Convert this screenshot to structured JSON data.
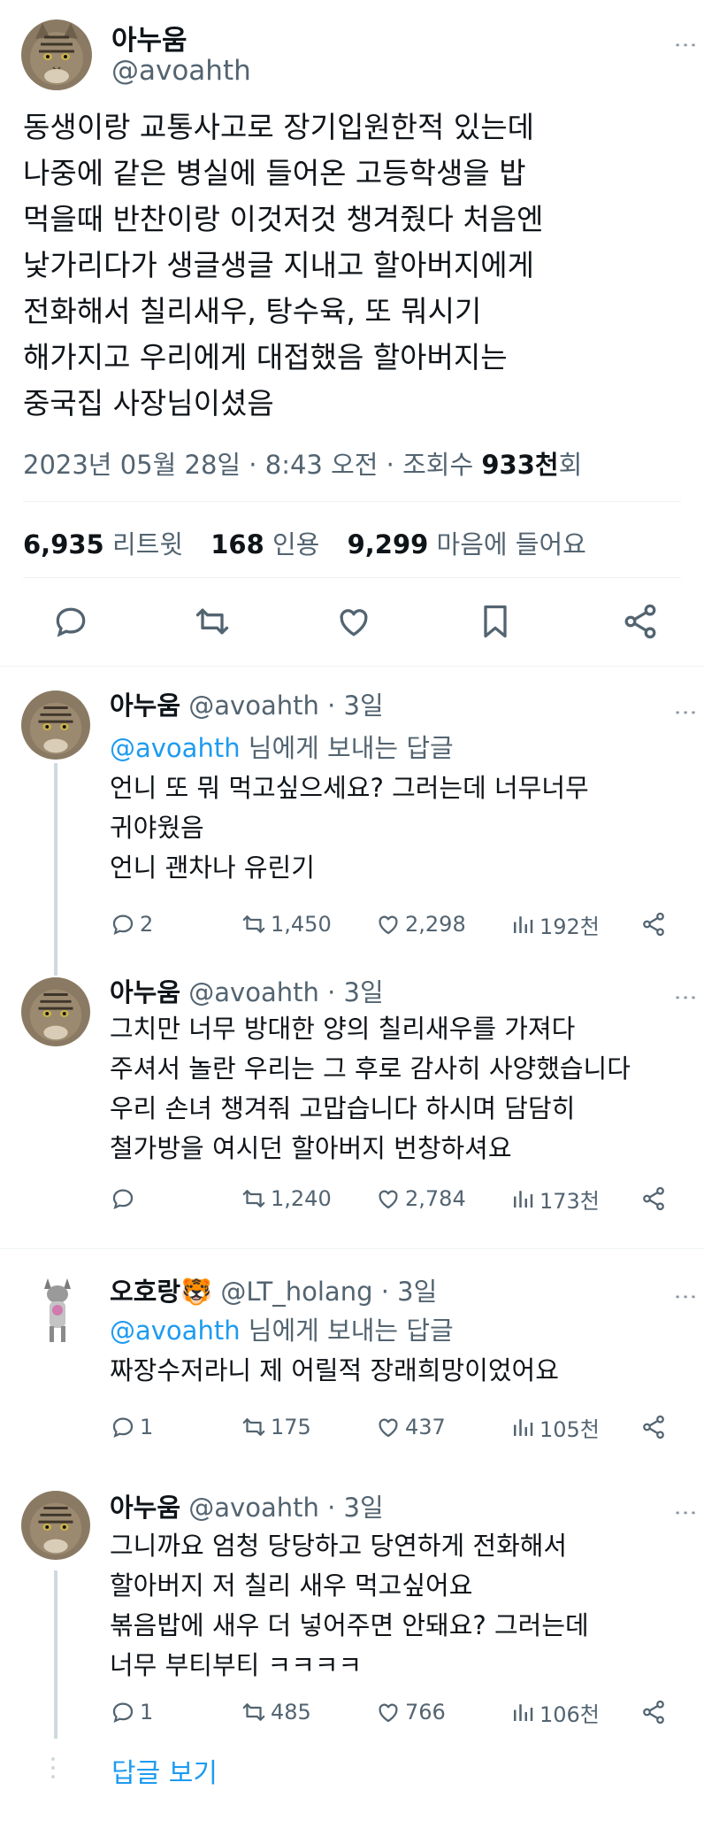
{
  "main": {
    "display_name": "아누움",
    "handle": "@avoahth",
    "text": "동생이랑 교통사고로 장기입원한적 있는데\n나중에 같은 병실에 들어온 고등학생을 밥\n먹을때 반찬이랑 이것저것 챙겨줬다 처음엔\n낯가리다가 생글생글 지내고 할아버지에게\n전화해서 칠리새우, 탕수육, 또 뭐시기\n해가지고 우리에게 대접했음 할아버지는\n중국집 사장님이셨음",
    "meta_date": "2023년 05월 28일 · 8:43 오전 · 조회수 ",
    "meta_views": "933천",
    "meta_views_suffix": "회",
    "retweets": "6,935",
    "retweets_label": "리트윗",
    "quotes": "168",
    "quotes_label": "인용",
    "likes": "9,299",
    "likes_label": "마음에 들어요",
    "actions": [
      "reply-icon",
      "retweet-icon",
      "like-icon",
      "bookmark-icon",
      "share-icon"
    ]
  },
  "replies": [
    {
      "display_name": "아누움",
      "handle": "@avoahth",
      "time": "· 3일",
      "replying_to": "@avoahth",
      "replying_suffix": " 님에게 보내는 답글",
      "text": "언니 또 뭐 먹고싶으세요? 그러는데 너무너무\n귀야웠음\n언니 괜차나 유린기",
      "replies": "2",
      "retweets": "1,450",
      "likes": "2,298",
      "views": "192천"
    },
    {
      "display_name": "아누움",
      "handle": "@avoahth",
      "time": "· 3일",
      "text": "그치만 너무 방대한 양의 칠리새우를 가져다\n주셔서 놀란 우리는 그 후로 감사히 사양했습니다\n우리 손녀 챙겨줘 고맙습니다 하시며 담담히\n철가방을 여시던 할아버지 번창하셔요",
      "replies": "",
      "retweets": "1,240",
      "likes": "2,784",
      "views": "173천"
    },
    {
      "display_name": "오호랑🐯",
      "handle": "@LT_holang",
      "time": "· 3일",
      "replying_to": "@avoahth",
      "replying_suffix": " 님에게 보내는 답글",
      "text": "짜장수저라니 제 어릴적 장래희망이었어요",
      "replies": "1",
      "retweets": "175",
      "likes": "437",
      "views": "105천"
    },
    {
      "display_name": "아누움",
      "handle": "@avoahth",
      "time": "· 3일",
      "text": "그니까요 엄청 당당하고 당연하게 전화해서\n할아버지 저 칠리 새우 먹고싶어요\n볶음밥에 새우 더 넣어주면 안돼요? 그러는데\n너무 부티부티 ㅋㅋㅋㅋ",
      "replies": "1",
      "retweets": "485",
      "likes": "766",
      "views": "106천"
    }
  ],
  "show_replies": "답글 보기",
  "colors": {
    "accent": "#1d9bf0",
    "muted": "#536471",
    "text": "#0f1419",
    "line": "#cfd9de"
  }
}
